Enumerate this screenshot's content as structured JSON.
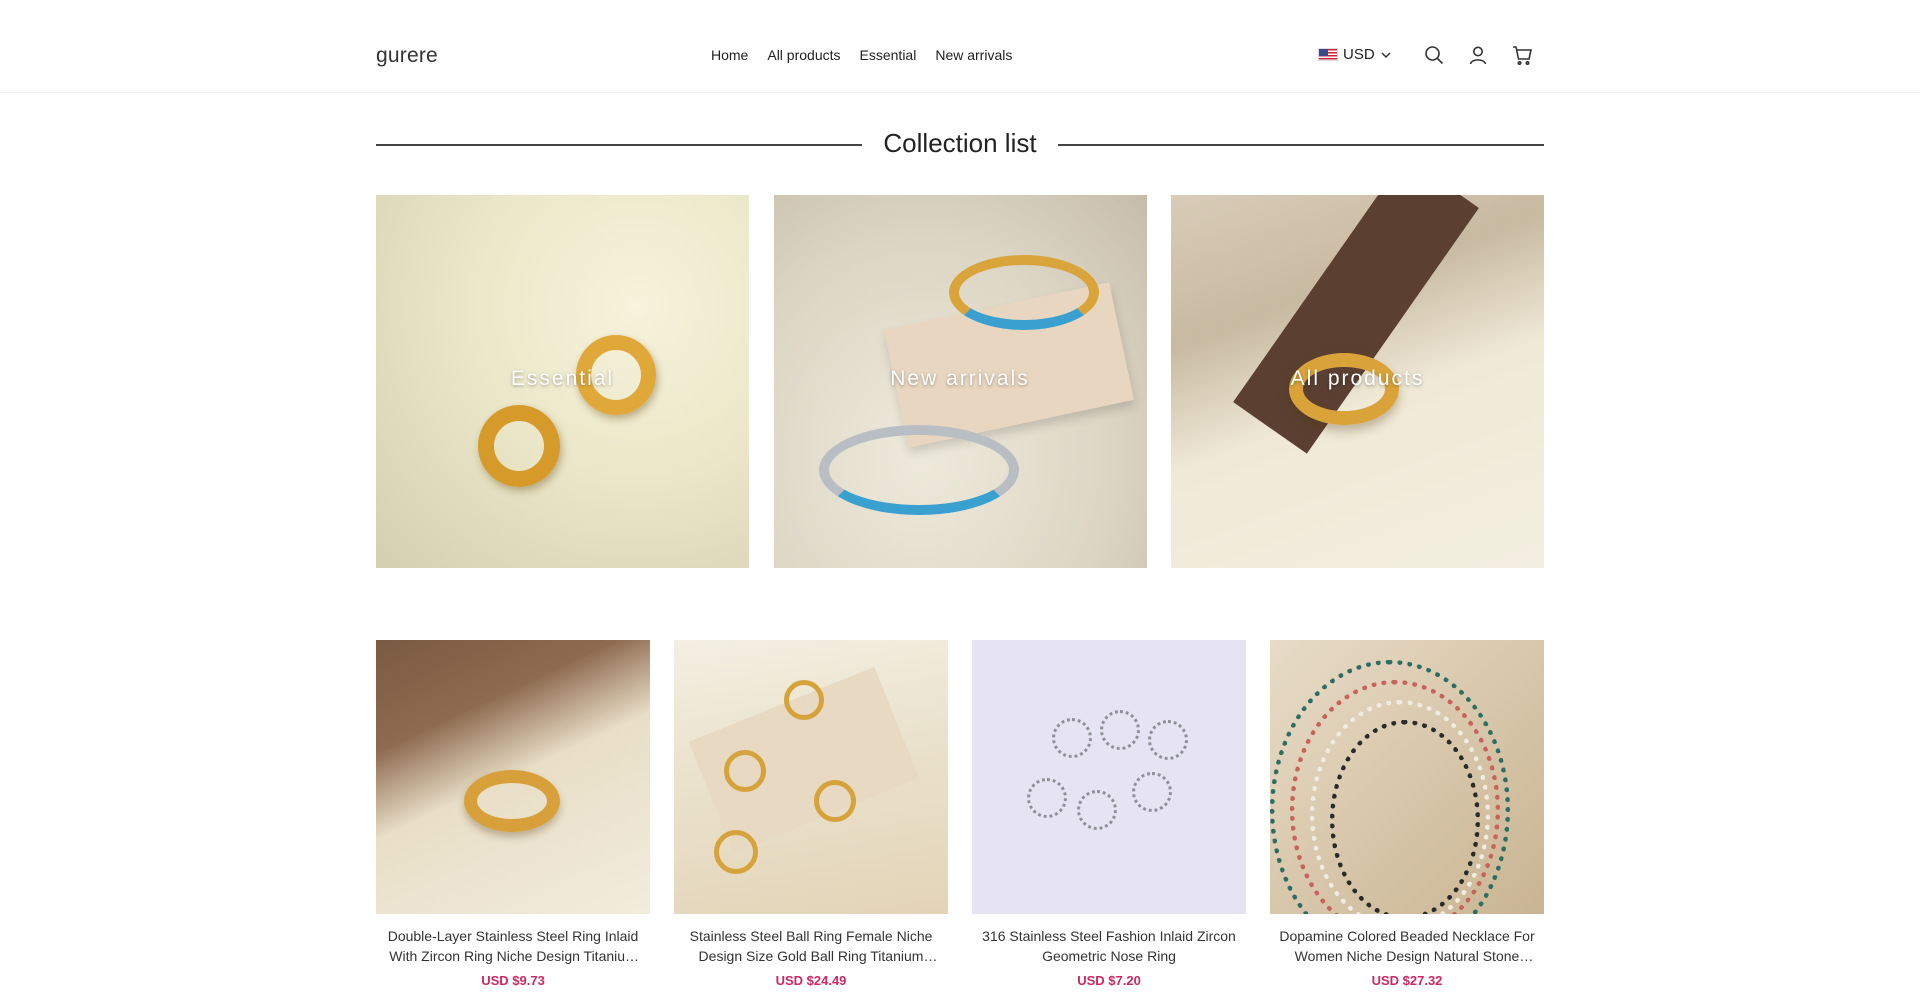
{
  "header": {
    "logo": "gurere",
    "nav": [
      "Home",
      "All products",
      "Essential",
      "New arrivals"
    ],
    "currency": "USD",
    "icons": [
      "search-icon",
      "account-icon",
      "cart-icon"
    ]
  },
  "collections": {
    "title": "Collection list",
    "items": [
      {
        "label": "Essential"
      },
      {
        "label": "New arrivals"
      },
      {
        "label": "All products"
      }
    ]
  },
  "products": [
    {
      "name": "Double-Layer Stainless Steel Ring Inlaid With Zircon Ring Niche Design Titanium Steel Ring",
      "price": "USD $9.73"
    },
    {
      "name": "Stainless Steel Ball Ring Female Niche Design Size Gold Ball Ring Titanium Steel Ring",
      "price": "USD $24.49"
    },
    {
      "name": "316 Stainless Steel Fashion Inlaid Zircon Geometric Nose Ring",
      "price": "USD $7.20"
    },
    {
      "name": "Dopamine Colored Beaded Necklace For Women Niche Design Natural Stone Necklace",
      "price": "USD $27.32"
    }
  ],
  "colors": {
    "price": "#d02760",
    "border": "#ececec"
  }
}
